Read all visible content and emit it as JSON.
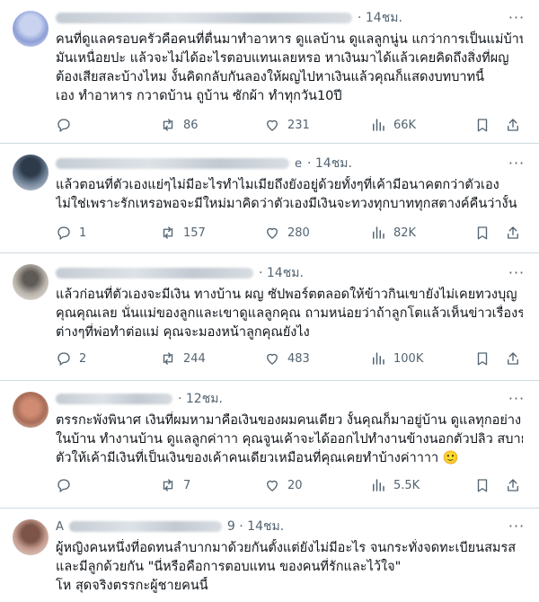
{
  "tweets": [
    {
      "name_visible": "",
      "time": "· 14ชม.",
      "lines": [
        "คนที่ดูแลครอบครัวคือคนที่ตื่นมาทำอาหาร ดูแลบ้าน ดูแลลูกนู่น แกว่าการเป็นแม่บ้าน",
        "มันเหนื่อยปะ แล้วจะไม่ได้อะไรตอบแทนเลยหรอ หาเงินมาได้แล้วเคยคิดถึงสิ่งที่ผญ",
        "ต้องเสียสละบ้างไหม งั้นคิดกลับกันลองให้ผญไปหาเงินแล้วคุณก็แสดงบทบาทนี้",
        "เอง ทำอาหาร กวาดบ้าน ถูบ้าน ซักผ้า ทำทุกวัน10ปี"
      ],
      "reply": "",
      "retweet": "86",
      "like": "231",
      "views": "66K"
    },
    {
      "name_visible": "e",
      "time": "· 14ชม.",
      "lines": [
        "แล้วตอนที่ตัวเองแย่ๆไม่มีอะไรทำไมเมียถึงยังอยู่ด้วยทั้งๆที่เค้ามีอนาคตกว่าตัวเอง",
        "ไม่ใช่เพราะรักเหรอพอจะมีใหม่มาคิดว่าตัวเองมีเงินจะทวงทุกบาททุกสตางค์คืนว่างั้น"
      ],
      "reply": "1",
      "retweet": "157",
      "like": "280",
      "views": "82K"
    },
    {
      "name_visible": "",
      "time": "· 14ชม.",
      "lines": [
        "แล้วก่อนที่ตัวเองจะมีเงิน ทางบ้าน ผญ ซัปพอร์ตตลอดให้ข้าวกินเขายังไม่เคยทวงบุญ",
        "คุณคุณเลย นั่นแม่ของลูกและเขาดูแลลูกคุณ ถามหน่อยว่าถ้าลูกโตแล้วเห็นข่าวเรื่องราว",
        "ต่างๆที่พ่อทำต่อแม่ คุณจะมองหน้าลูกคุณยังไง"
      ],
      "reply": "2",
      "retweet": "244",
      "like": "483",
      "views": "100K"
    },
    {
      "name_visible": "",
      "time": "· 12ชม.",
      "lines": [
        "ตรรกะพังพินาศ เงินที่ผมหามาคือเงินของผมคนเดียว งั้นคุณก็มาอยู่บ้าน ดูแลทุกอย่าง",
        "ในบ้าน ทำงานบ้าน ดูแลลูกค่าาา คุณจูนเค้าจะได้ออกไปทำงานข้างนอกตัวปลิว สบาย",
        "ตัวให้เค้ามีเงินที่เป็นเงินของเค้าคนเดียวเหมือนที่คุณเคยทำบ้างค่าาาา 🙂"
      ],
      "reply": "",
      "retweet": "7",
      "like": "20",
      "views": "5.5K"
    },
    {
      "name_visible": "A",
      "time": "9 · 14ชม.",
      "lines": [
        "ผู้หญิงคนหนึ่งที่อดทนลำบากมาด้วยกันตั้งแต่ยังไม่มีอะไร จนกระทั่งจดทะเบียนสมรส",
        "และมีลูกด้วยกัน \"นี่หรือคือการตอบแทน ของคนที่รักและไว้ใจ\"",
        "โห สุดจริงตรรกะผู้ชายคนนี้"
      ],
      "reply": "",
      "retweet": "",
      "like": "",
      "views": ""
    }
  ],
  "icons": {
    "reply": "reply-icon",
    "retweet": "retweet-icon",
    "like": "like-icon",
    "views": "views-icon",
    "bookmark": "bookmark-icon",
    "share": "share-icon",
    "more": "more-icon"
  },
  "colors": {
    "text": "#0f1419",
    "muted": "#536471",
    "divider": "#cfd9de"
  }
}
